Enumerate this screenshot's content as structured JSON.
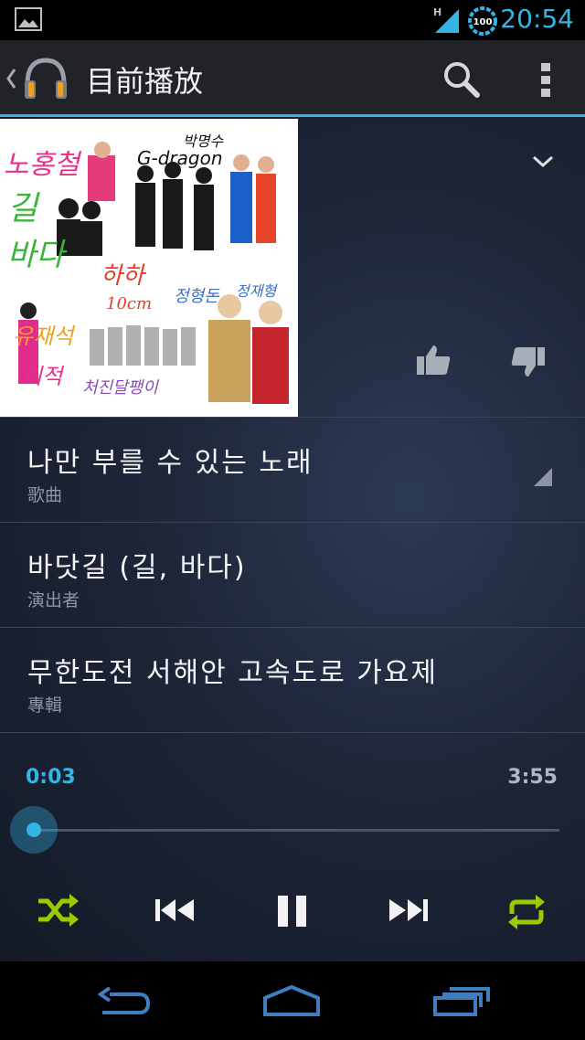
{
  "status_bar": {
    "time": "20:54",
    "battery_level": "100",
    "network_type": "H",
    "icons": [
      "gallery-icon",
      "signal-icon",
      "battery-icon"
    ]
  },
  "action_bar": {
    "title": "目前播放",
    "icons": [
      "up-icon",
      "headphones-app-icon",
      "search-icon",
      "overflow-menu-icon"
    ]
  },
  "album": {
    "art_text_lines": [
      "노홍철",
      "길",
      "바다",
      "G-dragon",
      "박명수",
      "정형돈",
      "정재형",
      "유재석",
      "이적",
      "하하",
      "10cm",
      "처진달팽이"
    ]
  },
  "track": {
    "song_title": "나만 부를 수 있는 노래",
    "song_label": "歌曲",
    "artist": "바닷길 (길, 바다)",
    "artist_label": "演出者",
    "album_title": "무한도전 서해안 고속도로 가요제",
    "album_label": "專輯"
  },
  "playback": {
    "current_time": "0:03",
    "total_time": "3:55",
    "progress_fraction": 0.013
  },
  "controls": [
    "shuffle-icon",
    "previous-icon",
    "pause-icon",
    "next-icon",
    "repeat-icon"
  ],
  "colors": {
    "accent": "#33b5e5",
    "control_green": "#99cc00",
    "background": "#1d2538"
  },
  "nav_bar": [
    "back-icon",
    "home-icon",
    "recent-apps-icon"
  ]
}
